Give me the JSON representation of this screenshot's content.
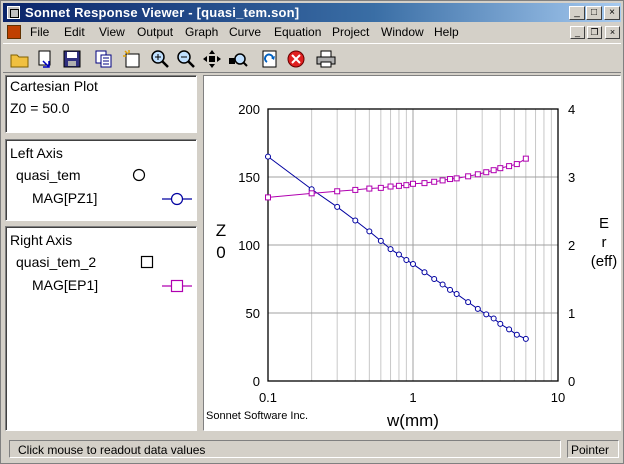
{
  "window": {
    "title": "Sonnet Response Viewer - [quasi_tem.son]"
  },
  "menu": [
    "File",
    "Edit",
    "View",
    "Output",
    "Graph",
    "Curve",
    "Equation",
    "Project",
    "Window",
    "Help"
  ],
  "toolbar": {
    "icons": [
      "open-folder-icon",
      "open-file-icon",
      "save-icon",
      "copy-icon",
      "new-plot-icon",
      "zoom-in-icon",
      "zoom-out-icon",
      "pan-icon",
      "zoom-fit-icon",
      "refresh-icon",
      "stop-icon",
      "print-icon"
    ]
  },
  "panels": {
    "plot": {
      "heading": "Cartesian Plot",
      "param": "Z0 = 50.0"
    },
    "left_axis": {
      "heading": "Left Axis",
      "project": "quasi_tem",
      "curve": "MAG[PZ1]",
      "marker": "circle",
      "color": "#0000a0"
    },
    "right_axis": {
      "heading": "Right Axis",
      "project": "quasi_tem_2",
      "curve": "MAG[EP1]",
      "marker": "square",
      "color": "#b000b0"
    }
  },
  "status": {
    "message": "Click mouse to readout data values",
    "mode": "Pointer"
  },
  "chart_data": {
    "type": "line",
    "xscale": "log",
    "xlim": [
      0.1,
      10
    ],
    "xticks": [
      "0.1",
      "1",
      "10"
    ],
    "xlabel": "w(mm)",
    "ylim_left": [
      0,
      200
    ],
    "yticks_left": [
      "0",
      "50",
      "100",
      "150",
      "200"
    ],
    "ylabel_left": "Z0",
    "ylim_right": [
      0,
      4
    ],
    "yticks_right": [
      "0",
      "1",
      "2",
      "3",
      "4"
    ],
    "ylabel_right": "Er (eff)",
    "grid": true,
    "watermark": "Sonnet Software Inc.",
    "series": [
      {
        "name": "MAG[PZ1]",
        "axis": "left",
        "marker": "circle",
        "color": "#0000a0",
        "x": [
          0.1,
          0.2,
          0.3,
          0.4,
          0.5,
          0.6,
          0.7,
          0.8,
          0.9,
          1.0,
          1.2,
          1.4,
          1.6,
          1.8,
          2.0,
          2.4,
          2.8,
          3.2,
          3.6,
          4.0,
          4.6,
          5.2,
          6.0
        ],
        "values": [
          165,
          141,
          128,
          118,
          110,
          103,
          97,
          93,
          89,
          86,
          80,
          75,
          71,
          67,
          64,
          58,
          53,
          49,
          46,
          42,
          38,
          34,
          31
        ]
      },
      {
        "name": "MAG[EP1]",
        "axis": "right",
        "marker": "square",
        "color": "#b000b0",
        "x": [
          0.1,
          0.2,
          0.3,
          0.4,
          0.5,
          0.6,
          0.7,
          0.8,
          0.9,
          1.0,
          1.2,
          1.4,
          1.6,
          1.8,
          2.0,
          2.4,
          2.8,
          3.2,
          3.6,
          4.0,
          4.6,
          5.2,
          6.0
        ],
        "values": [
          2.7,
          2.76,
          2.79,
          2.81,
          2.83,
          2.84,
          2.86,
          2.87,
          2.88,
          2.9,
          2.91,
          2.93,
          2.95,
          2.97,
          2.98,
          3.01,
          3.04,
          3.07,
          3.1,
          3.13,
          3.16,
          3.19,
          3.27
        ]
      }
    ]
  }
}
